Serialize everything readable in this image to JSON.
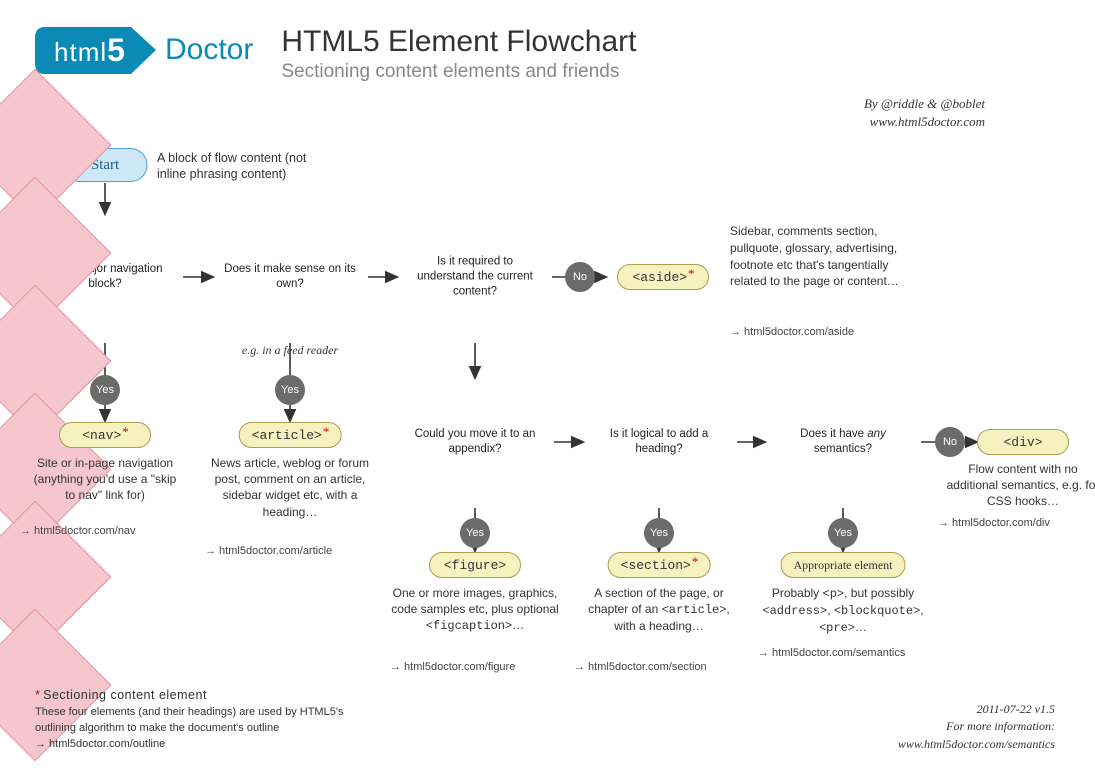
{
  "header": {
    "logo_html": "html",
    "logo_5": "5",
    "logo_doctor": "Doctor",
    "title": "HTML5 Element Flowchart",
    "subtitle": "Sectioning content elements and friends"
  },
  "byline": {
    "line1": "By @riddle & @boblet",
    "line2": "www.html5doctor.com"
  },
  "start": {
    "label": "Start",
    "desc": "A block of flow content (not inline phrasing content)"
  },
  "diamonds": {
    "nav": "Is it a major navigation block?",
    "article": "Does it make sense on its own?",
    "article_annot": "e.g. in a feed reader",
    "aside": "Is it required to understand the current content?",
    "figure": "Could you move it to an appendix?",
    "section": "Is it logical to add a heading?",
    "semantics": "Does it have any semantics?"
  },
  "badges": {
    "yes": "Yes",
    "no": "No"
  },
  "results": {
    "nav": "<nav>",
    "article": "<article>",
    "aside": "<aside>",
    "figure": "<figure>",
    "section": "<section>",
    "semantics": "Appropriate element",
    "div": "<div>"
  },
  "descriptions": {
    "nav": "Site or in-page navigation (anything you'd use a \"skip to nav\" link for)",
    "article": "News article, weblog or forum post, comment on an article, sidebar widget etc, with a heading…",
    "aside": "Sidebar, comments section, pullquote, glossary, advertising, footnote etc that's tangentially related to the page or content…",
    "figure": "One or more images, graphics, code samples etc, plus optional <figcaption>…",
    "section": "A section of the page, or chapter of an <article>, with a heading…",
    "semantics": "Probably <p>, but possibly <address>, <blockquote>, <pre>…",
    "div": "Flow content with no additional semantics, e.g. for CSS hooks…"
  },
  "links": {
    "nav": "→ html5doctor.com/nav",
    "article": "→ html5doctor.com/article",
    "aside": "→ html5doctor.com/aside",
    "figure": "→ html5doctor.com/figure",
    "section": "→ html5doctor.com/section",
    "semantics": "→ html5doctor.com/semantics",
    "div": "→ html5doctor.com/div"
  },
  "footnote": {
    "star": "*",
    "title": "Sectioning content element",
    "body": "These four elements (and their headings) are used by HTML5's outlining algorithm to make the document's outline",
    "link": "→ html5doctor.com/outline"
  },
  "version": {
    "date": "2011-07-22 v1.5",
    "more": "For more information:",
    "url": "www.html5doctor.com/semantics"
  }
}
